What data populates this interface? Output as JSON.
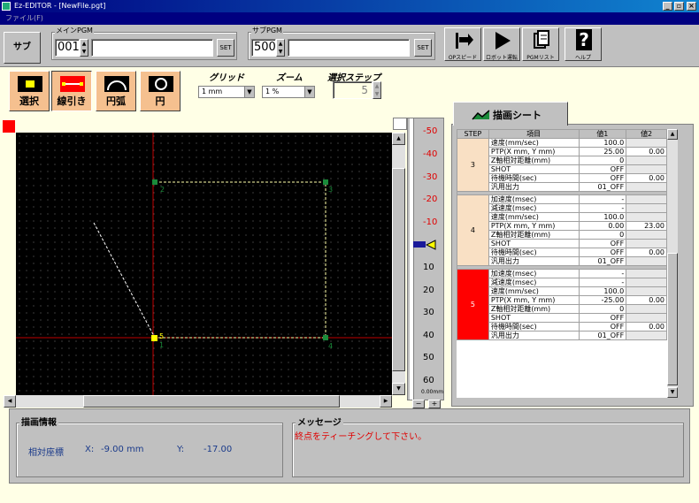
{
  "window": {
    "title": "Ez-EDITOR - [NewFile.pgt]",
    "menu": "ファイル(F)"
  },
  "toolbar": {
    "sub_button": "サブ",
    "main_pgm_label": "メインPGM",
    "main_pgm_value": "001",
    "set_label": "SET",
    "sub_pgm_label": "サブPGM",
    "sub_pgm_value": "500",
    "op_speed_label": "OPスピード",
    "robot_run_label": "ロボット運転",
    "pgm_list_label": "PGMリスト",
    "help_label": "ヘルプ"
  },
  "tools": [
    {
      "id": "select",
      "label": "選択"
    },
    {
      "id": "line",
      "label": "線引き"
    },
    {
      "id": "arc",
      "label": "円弧"
    },
    {
      "id": "circle",
      "label": "円"
    }
  ],
  "options": {
    "grid_label": "グリッド",
    "grid_value": "1 mm",
    "zoom_label": "ズーム",
    "zoom_value": "1 %",
    "step_label": "選択ステップ",
    "step_value": "5"
  },
  "canvas_labels": {
    "p1": "1",
    "p2": "2",
    "p3": "3",
    "p4": "4",
    "p5": "5"
  },
  "ruler": {
    "ticks": [
      "-50",
      "-40",
      "-30",
      "-20",
      "-10",
      "10",
      "20",
      "30",
      "40",
      "50",
      "60"
    ],
    "unit": "0.00mm",
    "minus": "−",
    "plus": "+"
  },
  "sheet": {
    "tab_label": "描画シート",
    "headers": {
      "step": "STEP",
      "item": "項目",
      "val1": "値1",
      "val2": "値2"
    },
    "groups": [
      {
        "step": "3",
        "rows": [
          {
            "item": "速度(mm/sec)",
            "v1": "100.0",
            "v2": ""
          },
          {
            "item": "PTP(X mm, Y mm)",
            "v1": "25.00",
            "v2": "0.00"
          },
          {
            "item": "Z軸相対距離(mm)",
            "v1": "0",
            "v2": ""
          },
          {
            "item": "SHOT",
            "v1": "OFF",
            "v2": ""
          },
          {
            "item": "待機時間(sec)",
            "v1": "OFF",
            "v2": "0.00"
          },
          {
            "item": "汎用出力",
            "v1": "01_OFF",
            "v2": ""
          }
        ]
      },
      {
        "step": "4",
        "rows": [
          {
            "item": "加速度(msec)",
            "v1": "-",
            "v2": ""
          },
          {
            "item": "減速度(msec)",
            "v1": "-",
            "v2": ""
          },
          {
            "item": "速度(mm/sec)",
            "v1": "100.0",
            "v2": ""
          },
          {
            "item": "PTP(X mm, Y mm)",
            "v1": "0.00",
            "v2": "23.00"
          },
          {
            "item": "Z軸相対距離(mm)",
            "v1": "0",
            "v2": ""
          },
          {
            "item": "SHOT",
            "v1": "OFF",
            "v2": ""
          },
          {
            "item": "待機時間(sec)",
            "v1": "OFF",
            "v2": "0.00"
          },
          {
            "item": "汎用出力",
            "v1": "01_OFF",
            "v2": ""
          }
        ]
      },
      {
        "step": "5",
        "rows": [
          {
            "item": "加速度(msec)",
            "v1": "-",
            "v2": ""
          },
          {
            "item": "減速度(msec)",
            "v1": "-",
            "v2": ""
          },
          {
            "item": "速度(mm/sec)",
            "v1": "100.0",
            "v2": ""
          },
          {
            "item": "PTP(X mm, Y mm)",
            "v1": "-25.00",
            "v2": "0.00"
          },
          {
            "item": "Z軸相対距離(mm)",
            "v1": "0",
            "v2": ""
          },
          {
            "item": "SHOT",
            "v1": "OFF",
            "v2": ""
          },
          {
            "item": "待機時間(sec)",
            "v1": "OFF",
            "v2": "0.00"
          },
          {
            "item": "汎用出力",
            "v1": "01_OFF",
            "v2": ""
          }
        ]
      }
    ]
  },
  "info": {
    "title": "描画情報",
    "rel_label": "相対座標",
    "x_label": "X:",
    "x_value": "-9.00 mm",
    "y_label": "Y:",
    "y_value": "-17.00"
  },
  "message": {
    "title": "メッセージ",
    "text": "終点をティーチングして下さい。"
  },
  "colors": {
    "accent_red": "#ff0000",
    "tool_orange": "#f5c08f",
    "step_band": "#f9e0c4"
  }
}
